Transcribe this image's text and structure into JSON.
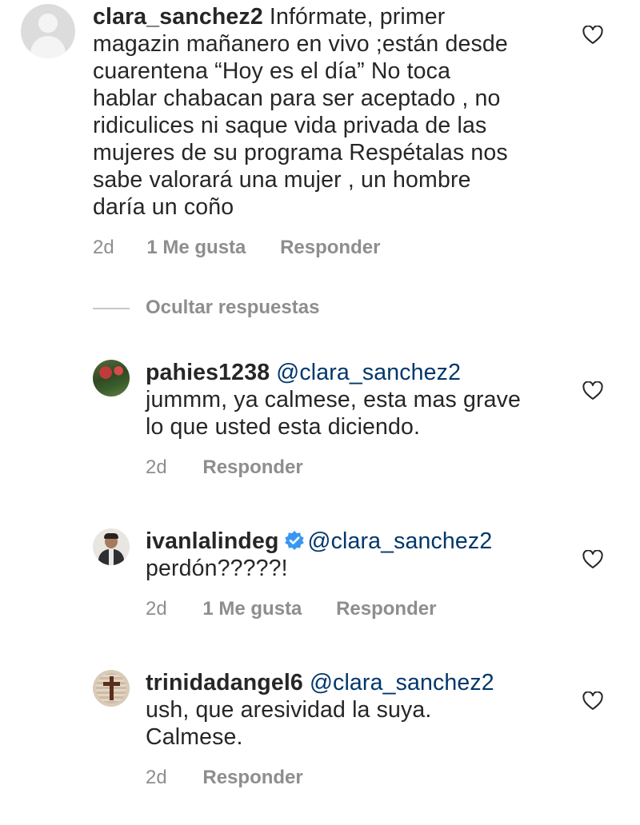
{
  "colors": {
    "text": "#262626",
    "meta": "#8e8e8e",
    "mention": "#00376b",
    "verified": "#3897f0"
  },
  "comment": {
    "username": "clara_sanchez2",
    "lines": [
      "Infórmate, primer",
      "magazin mañanero en vivo ;están desde",
      "cuarentena “Hoy es el día” No toca",
      "hablar chabacan para ser aceptado , no",
      "ridiculices ni saque vida privada de las",
      "mujeres de su programa Respétalas nos",
      "sabe valorará una mujer , un hombre",
      "daría  un coño"
    ],
    "time": "2d",
    "likes": "1 Me gusta",
    "reply": "Responder"
  },
  "hide_replies": "Ocultar respuestas",
  "replies": [
    {
      "username": "pahies1238",
      "mention": "@clara_sanchez2",
      "lines": [
        "jummm, ya calmese, esta mas grave",
        "lo que usted esta diciendo."
      ],
      "time": "2d",
      "reply": "Responder"
    },
    {
      "username": "ivanlalindeg",
      "verified": true,
      "mention": "@clara_sanchez2",
      "lines": [
        "perdón?????!"
      ],
      "time": "2d",
      "likes": "1 Me gusta",
      "reply": "Responder"
    },
    {
      "username": "trinidadangel6",
      "mention": "@clara_sanchez2",
      "lines": [
        "ush, que aresividad la suya.",
        "Calmese."
      ],
      "time": "2d",
      "reply": "Responder"
    }
  ],
  "icons": {
    "like": "heart-outline-icon",
    "verified": "verified-badge-icon",
    "default_avatar": "default-avatar-icon"
  }
}
